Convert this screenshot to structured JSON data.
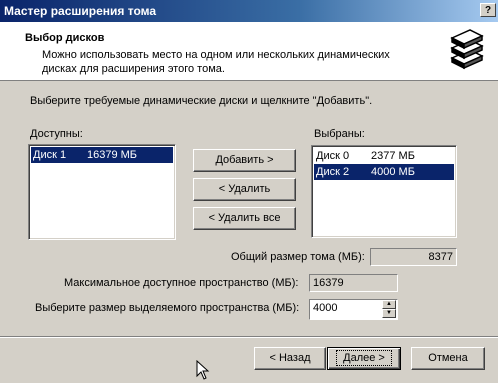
{
  "window": {
    "title": "Мастер расширения тома",
    "help_label": "?"
  },
  "header": {
    "title": "Выбор дисков",
    "description": "Можно использовать место на одном или нескольких динамических дисках для расширения этого тома.",
    "icon": "disks-stack-icon"
  },
  "instruction": "Выберите требуемые динамические диски и щелкните \"Добавить\".",
  "available": {
    "label": "Доступны:",
    "items": [
      {
        "disk": "Диск 1",
        "size": "16379 МБ",
        "selected": true
      }
    ]
  },
  "selected": {
    "label": "Выбраны:",
    "items": [
      {
        "disk": "Диск 0",
        "size": "2377 МБ",
        "selected": false
      },
      {
        "disk": "Диск 2",
        "size": "4000 МБ",
        "selected": true
      }
    ]
  },
  "buttons": {
    "add": "Добавить >",
    "remove": "< Удалить",
    "remove_all": "< Удалить все",
    "back": "< Назад",
    "next": "Далее >",
    "cancel": "Отмена"
  },
  "fields": {
    "total_label": "Общий размер тома (МБ):",
    "total_value": "8377",
    "max_label": "Максимальное доступное пространство (МБ):",
    "max_value": "16379",
    "alloc_label": "Выберите размер выделяемого пространства (МБ):",
    "alloc_value": "4000"
  },
  "colors": {
    "selection": "#0a246a",
    "dialog": "#d4d0c8",
    "title_start": "#0a246a"
  }
}
